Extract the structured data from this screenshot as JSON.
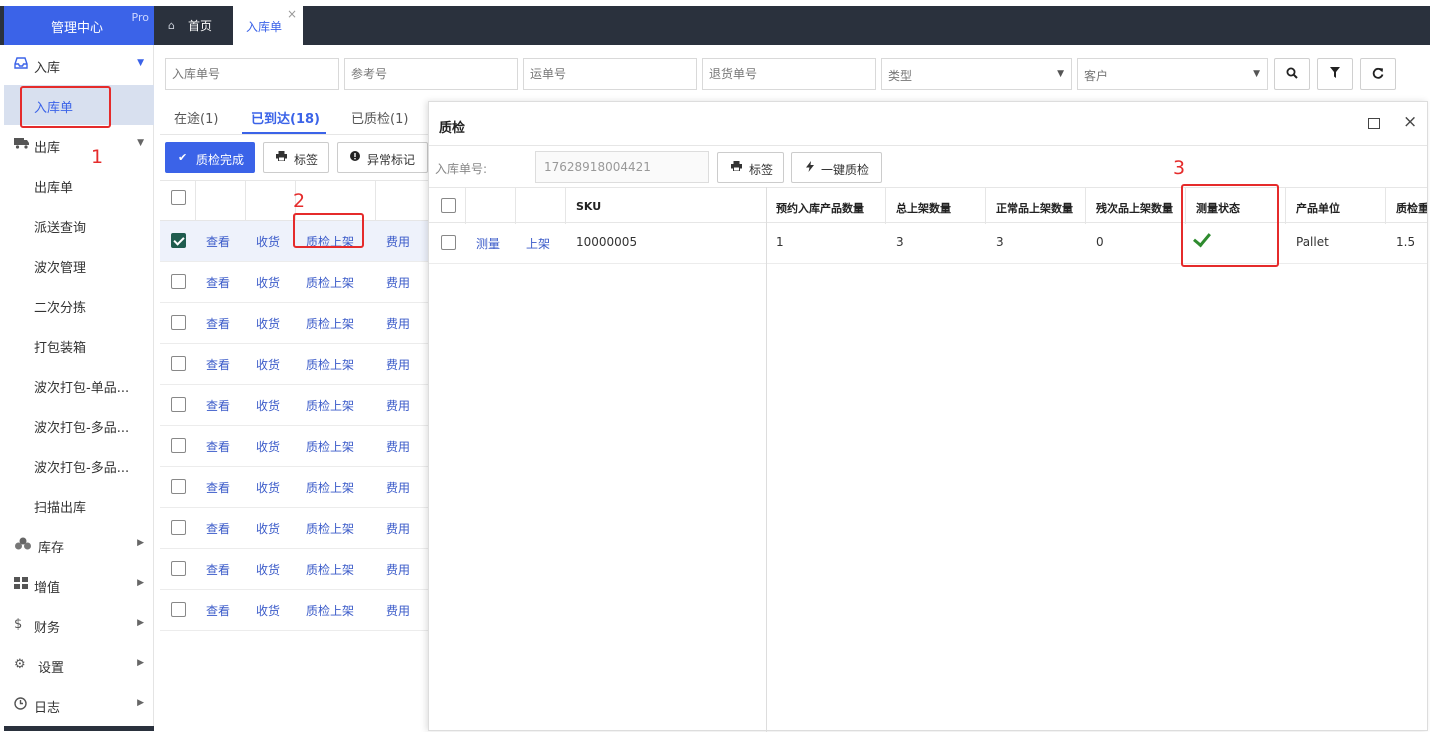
{
  "header": {
    "logo_title": "管理中心",
    "logo_badge": "Pro",
    "tabs": [
      {
        "label": "首页",
        "icon": "home-icon"
      },
      {
        "label": "入库单",
        "icon": "",
        "closable": true
      }
    ],
    "close_glyph": "×"
  },
  "sidebar": {
    "items": [
      {
        "label": "入库",
        "icon": "inbox-icon",
        "expanded": true
      },
      {
        "label": "入库单",
        "sub": true,
        "active": true
      },
      {
        "label": "出库",
        "icon": "truck-icon",
        "expanded": true
      },
      {
        "label": "出库单",
        "sub": true
      },
      {
        "label": "派送查询",
        "sub": true
      },
      {
        "label": "波次管理",
        "sub": true
      },
      {
        "label": "二次分拣",
        "sub": true
      },
      {
        "label": "打包装箱",
        "sub": true
      },
      {
        "label": "波次打包-单品...",
        "sub": true
      },
      {
        "label": "波次打包-多品...",
        "sub": true
      },
      {
        "label": "波次打包-多品...",
        "sub": true
      },
      {
        "label": "扫描出库",
        "sub": true
      },
      {
        "label": "库存",
        "icon": "cubes-icon"
      },
      {
        "label": "增值",
        "icon": "grid-icon"
      },
      {
        "label": "财务",
        "icon": "dollar-icon"
      },
      {
        "label": "设置",
        "icon": "gears-icon"
      },
      {
        "label": "日志",
        "icon": "clock-icon"
      }
    ]
  },
  "search": {
    "inbound_no_placeholder": "入库单号",
    "reference_no_placeholder": "参考号",
    "waybill_no_placeholder": "运单号",
    "return_no_placeholder": "退货单号",
    "type_placeholder": "类型",
    "customer_placeholder": "客户"
  },
  "status_tabs": [
    {
      "label": "在途(1)"
    },
    {
      "label": "已到达(18)",
      "active": true
    },
    {
      "label": "已质检(1)"
    }
  ],
  "actions": {
    "qc_complete": "质检完成",
    "label": "标签",
    "exception_mark": "异常标记"
  },
  "left_table": {
    "row_actions": {
      "view": "查看",
      "receive": "收货",
      "qc_shelve": "质检上架",
      "fee": "费用"
    },
    "rows": [
      {
        "checked": true
      },
      {
        "checked": false
      },
      {
        "checked": false
      },
      {
        "checked": false
      },
      {
        "checked": false
      },
      {
        "checked": false
      },
      {
        "checked": false
      },
      {
        "checked": false
      },
      {
        "checked": false
      },
      {
        "checked": false
      }
    ]
  },
  "modal": {
    "title": "质检",
    "ref_label": "入库单号:",
    "ref_value": "17628918004421",
    "label_button": "标签",
    "one_click_qc_button": "一键质检",
    "columns": [
      "SKU",
      "预约入库产品数量",
      "总上架数量",
      "正常品上架数量",
      "残次品上架数量",
      "测量状态",
      "产品单位",
      "质检重"
    ],
    "row": {
      "measure_link": "测量",
      "shelve_link": "上架",
      "sku": "10000005",
      "reserved_qty": "1",
      "total_shelved": "3",
      "normal_shelved": "3",
      "defective_shelved": "0",
      "measure_status": "check-icon",
      "unit": "Pallet",
      "qc_weight": "1.5"
    }
  },
  "annotations": [
    "1",
    "2",
    "3"
  ],
  "colors": {
    "accent": "#3b63e8",
    "topbar": "#2a313d",
    "annotation": "#e52b2b",
    "check": "#2e8b2e"
  }
}
